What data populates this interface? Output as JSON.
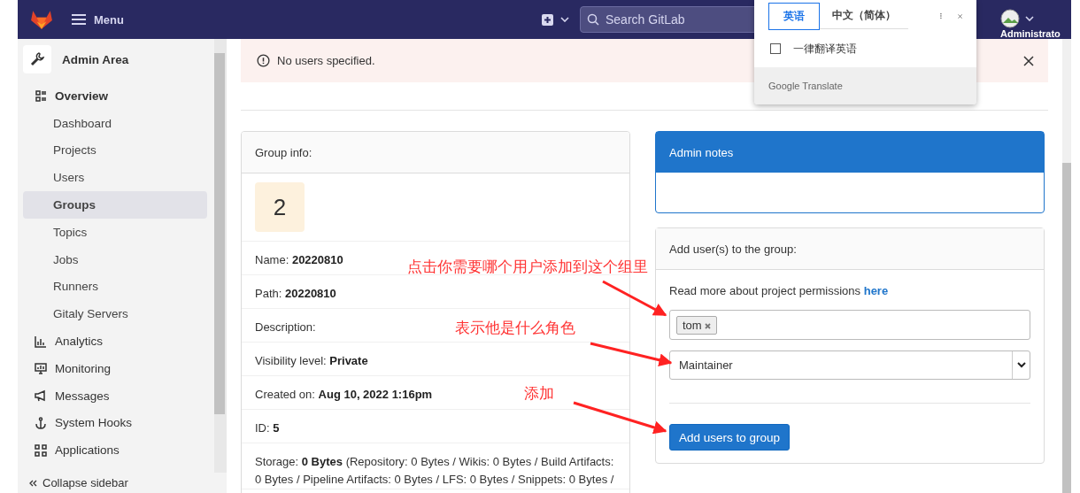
{
  "header": {
    "menu_label": "Menu",
    "search_placeholder": "Search GitLab",
    "user_label": "Administrato"
  },
  "sidebar": {
    "title": "Admin Area",
    "items": [
      {
        "label": "Overview",
        "kind": "section",
        "selected": false
      },
      {
        "label": "Dashboard",
        "kind": "sub",
        "selected": false
      },
      {
        "label": "Projects",
        "kind": "sub",
        "selected": false
      },
      {
        "label": "Users",
        "kind": "sub",
        "selected": false
      },
      {
        "label": "Groups",
        "kind": "sub",
        "selected": true
      },
      {
        "label": "Topics",
        "kind": "sub",
        "selected": false
      },
      {
        "label": "Jobs",
        "kind": "sub",
        "selected": false
      },
      {
        "label": "Runners",
        "kind": "sub",
        "selected": false
      },
      {
        "label": "Gitaly Servers",
        "kind": "sub",
        "selected": false
      },
      {
        "label": "Analytics",
        "kind": "section",
        "selected": false
      },
      {
        "label": "Monitoring",
        "kind": "section",
        "selected": false
      },
      {
        "label": "Messages",
        "kind": "section",
        "selected": false
      },
      {
        "label": "System Hooks",
        "kind": "section",
        "selected": false
      },
      {
        "label": "Applications",
        "kind": "section",
        "selected": false
      }
    ],
    "collapse_label": "Collapse sidebar"
  },
  "alert": {
    "message": "No users specified."
  },
  "group_info": {
    "title": "Group info:",
    "avatar_letter": "2",
    "fields": [
      {
        "text": "Name: **20220810**"
      },
      {
        "text": "Path: **20220810**"
      },
      {
        "text": "Description:"
      },
      {
        "text": "Visibility level: **Private**"
      },
      {
        "text": "Created on: **Aug 10, 2022 1:16pm**"
      },
      {
        "text": "ID: **5**"
      },
      {
        "text": "Storage: **0 Bytes** (Repository: 0 Bytes / Wikis: 0 Bytes / Build Artifacts: 0 Bytes / Pipeline Artifacts: 0 Bytes / LFS: 0 Bytes / Snippets: 0 Bytes /"
      }
    ]
  },
  "admin_notes": {
    "title": "Admin notes"
  },
  "add_users": {
    "title": "Add user(s) to the group:",
    "permissions_text": "Read more about project permissions",
    "permissions_link": "here",
    "tokens": [
      "tom"
    ],
    "role": "Maintainer",
    "submit": "Add users to group"
  },
  "annotations": [
    {
      "text": "点击你需要哪个用户添加到这个组里"
    },
    {
      "text": "表示他是什么角色"
    },
    {
      "text": "添加"
    }
  ],
  "translate_popup": {
    "tabs": [
      {
        "label": "英语",
        "selected": true
      },
      {
        "label": "中文（简体）",
        "selected": false
      }
    ],
    "option": {
      "label": "一律翻译英语",
      "checked": false
    },
    "footer": "Google Translate"
  }
}
